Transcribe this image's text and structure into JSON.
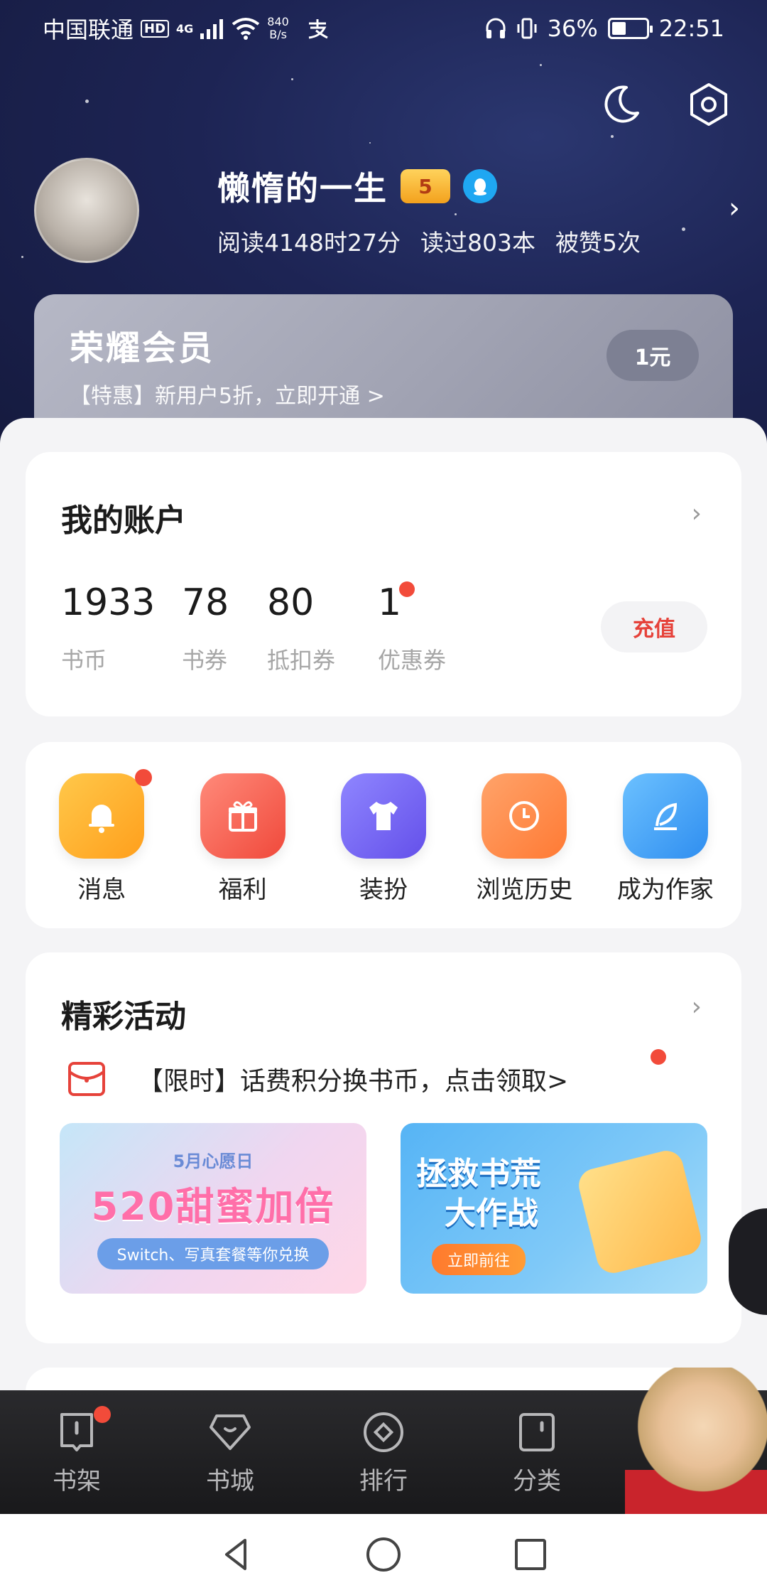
{
  "status_bar": {
    "carrier": "中国联通",
    "hd": "HD",
    "network": "4G",
    "speed_value": "840",
    "speed_unit": "B/s",
    "battery": "36%",
    "time": "22:51"
  },
  "profile": {
    "username": "懒惰的一生",
    "level": "5",
    "read_time": "阅读4148时27分",
    "books_read": "读过803本",
    "likes": "被赞5次"
  },
  "vip": {
    "title": "荣耀会员",
    "subtitle": "【特惠】新用户5折，立即开通 >",
    "price_button": "1元"
  },
  "account": {
    "title": "我的账户",
    "items": [
      {
        "value": "1933",
        "label": "书币"
      },
      {
        "value": "78",
        "label": "书券"
      },
      {
        "value": "80",
        "label": "抵扣券"
      },
      {
        "value": "1",
        "label": "优惠券"
      }
    ],
    "recharge_label": "充值"
  },
  "shortcuts": [
    {
      "label": "消息",
      "icon": "bell-icon",
      "color": "#ffb02e"
    },
    {
      "label": "福利",
      "icon": "gift-icon",
      "color": "#ff6b5b"
    },
    {
      "label": "装扮",
      "icon": "tshirt-icon",
      "color": "#7d6cf2"
    },
    {
      "label": "浏览历史",
      "icon": "clock-icon",
      "color": "#ff8a4a"
    },
    {
      "label": "成为作家",
      "icon": "feather-icon",
      "color": "#3ca4f5"
    }
  ],
  "events": {
    "title": "精彩活动",
    "promo_text": "【限时】话费积分换书币，点击领取>",
    "banner1": {
      "top": "5月心愿日",
      "main": "520甜蜜加倍",
      "sub": "Switch、写真套餐等你兑换"
    },
    "banner2": {
      "line1": "拯救书荒",
      "line2": "大作战",
      "button": "立即前往"
    }
  },
  "bottom_nav": [
    {
      "label": "书架",
      "icon": "bookshelf-icon"
    },
    {
      "label": "书城",
      "icon": "bookstore-icon"
    },
    {
      "label": "排行",
      "icon": "ranking-icon"
    },
    {
      "label": "分类",
      "icon": "category-icon"
    }
  ],
  "colors": {
    "accent_red": "#e6423a",
    "badge_red": "#f24b3a",
    "hero_bg": "#1d2454"
  }
}
